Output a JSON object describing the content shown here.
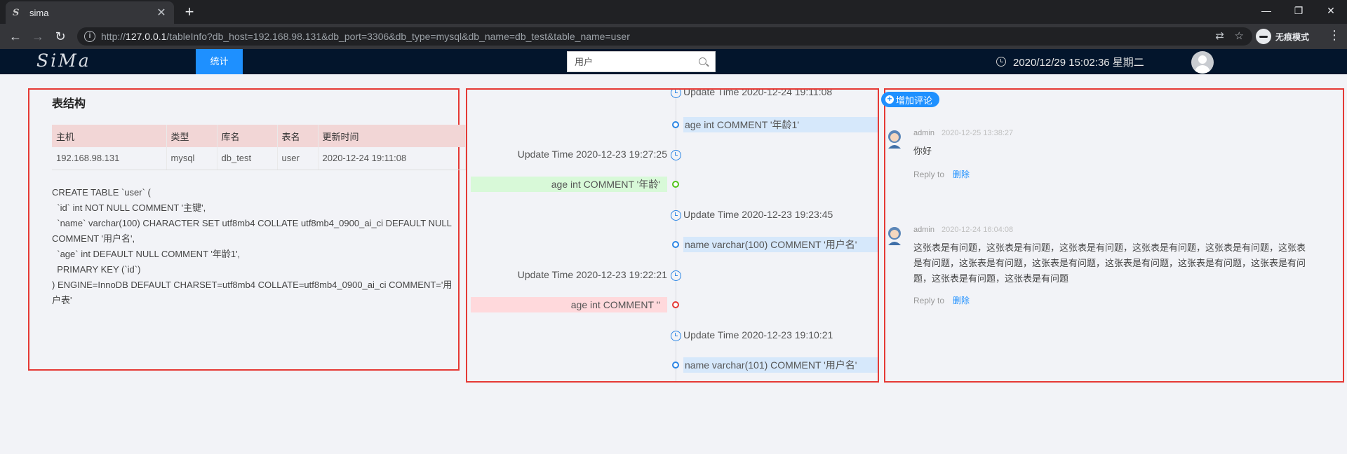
{
  "browser": {
    "tab_title": "sima",
    "tab_favicon": "S",
    "url_prefix": "http://",
    "url_host": "127.0.0.1",
    "url_path": "/tableInfo?db_host=192.168.98.131&db_port=3306&db_type=mysql&db_name=db_test&table_name=user",
    "incognito_label": "无痕模式"
  },
  "header": {
    "logo": "SiMa",
    "nav_stat": "统计",
    "search_placeholder": "用户",
    "datetime": "2020/12/29 15:02:36 星期二"
  },
  "structure": {
    "title": "表结构",
    "columns": [
      "主机",
      "类型",
      "库名",
      "表名",
      "更新时间"
    ],
    "row": [
      "192.168.98.131",
      "mysql",
      "db_test",
      "user",
      "2020-12-24 19:11:08"
    ],
    "sql": [
      "CREATE TABLE `user` (",
      "  `id` int NOT NULL COMMENT '主键',",
      "  `name` varchar(100) CHARACTER SET utf8mb4 COLLATE utf8mb4_0900_ai_ci DEFAULT NULL COMMENT '用户名',",
      "  `age` int DEFAULT NULL COMMENT '年龄1',",
      "  PRIMARY KEY (`id`)",
      ") ENGINE=InnoDB DEFAULT CHARSET=utf8mb4 COLLATE=utf8mb4_0900_ai_ci COMMENT='用户表'"
    ]
  },
  "timeline": {
    "t1": "Update Time 2020-12-24 19:11:08",
    "c1": "age int COMMENT '年龄1'",
    "t2": "Update Time 2020-12-23 19:27:25",
    "c2": "age int COMMENT '年龄'",
    "t3": "Update Time 2020-12-23 19:23:45",
    "c3": "name varchar(100) COMMENT '用户名'",
    "t4": "Update Time 2020-12-23 19:22:21",
    "c4": "age int COMMENT ''",
    "t5": "Update Time 2020-12-23 19:10:21",
    "c5": "name varchar(101) COMMENT '用户名'"
  },
  "comments": {
    "add_label": "增加评论",
    "items": [
      {
        "author": "admin",
        "time": "2020-12-25 13:38:27",
        "text": "你好",
        "reply": "Reply to",
        "delete": "删除"
      },
      {
        "author": "admin",
        "time": "2020-12-24 16:04:08",
        "text": "这张表是有问题，这张表是有问题，这张表是有问题，这张表是有问题，这张表是有问题，这张表是有问题，这张表是有问题，这张表是有问题，这张表是有问题，这张表是有问题，这张表是有问题，这张表是有问题，这张表是有问题",
        "reply": "Reply to",
        "delete": "删除"
      }
    ]
  },
  "colors": {
    "accent": "#1e90ff",
    "header_bg": "#03152c",
    "panel_border": "#e53935",
    "added": "#d8f9d8",
    "removed": "#ffd9dc",
    "changed": "#d6e8fb"
  }
}
